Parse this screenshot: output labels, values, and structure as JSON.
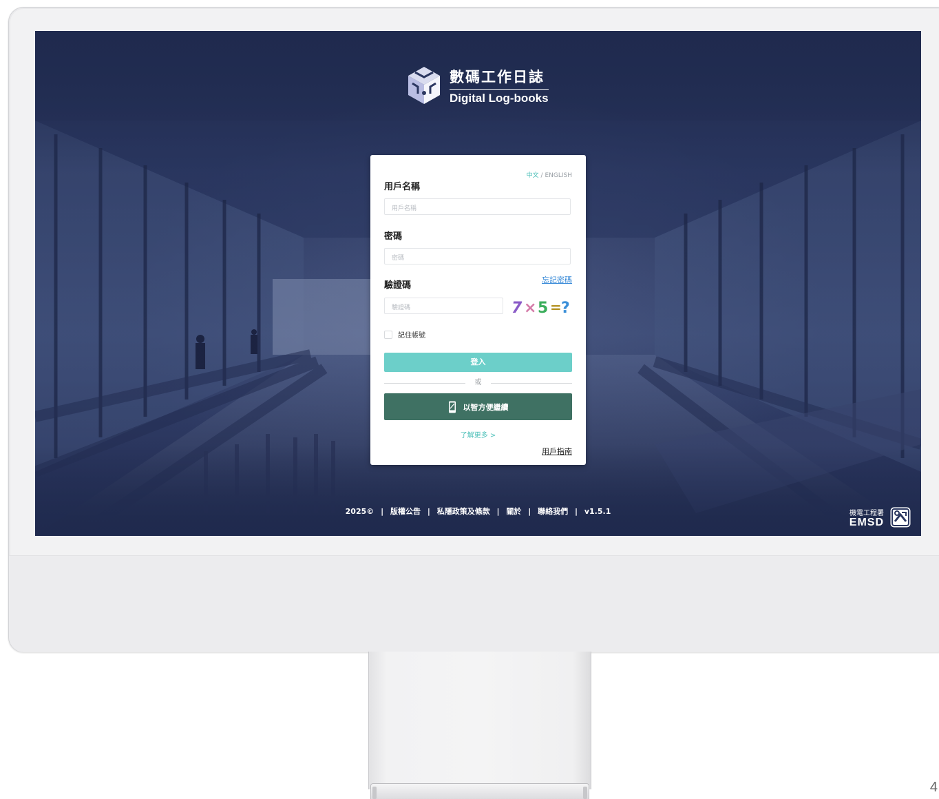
{
  "brand": {
    "title_zh": "數碼工作日誌",
    "title_en": "Digital Log-books"
  },
  "lang_switch": {
    "zh": "中文",
    "sep": " / ",
    "en": "ENGLISH"
  },
  "form": {
    "username_label": "用戶名稱",
    "username_placeholder": "用戶名稱",
    "password_label": "密碼",
    "password_placeholder": "密碼",
    "captcha_label": "驗證碼",
    "captcha_placeholder": "驗證碼",
    "forgot_password": "忘記密碼",
    "captcha_text": "7×5=?",
    "remember_label": "記住帳號",
    "login_button": "登入",
    "or_text": "或",
    "smart_button": "以智方便繼續",
    "learn_more": "了解更多 >",
    "user_guide": "用戶指南"
  },
  "footer": {
    "items": [
      "2025©",
      "版權公告",
      "私隱政策及條款",
      "關於",
      "聯絡我們",
      "v1.5.1"
    ],
    "separator": "|"
  },
  "org": {
    "name_zh": "機電工程署",
    "name_en": "EMSD"
  },
  "page_number": "4",
  "colors": {
    "accent": "#6ccfc9",
    "smart": "#3f7163",
    "link": "#3a8bd8",
    "screen_bg": "#2b3760"
  }
}
